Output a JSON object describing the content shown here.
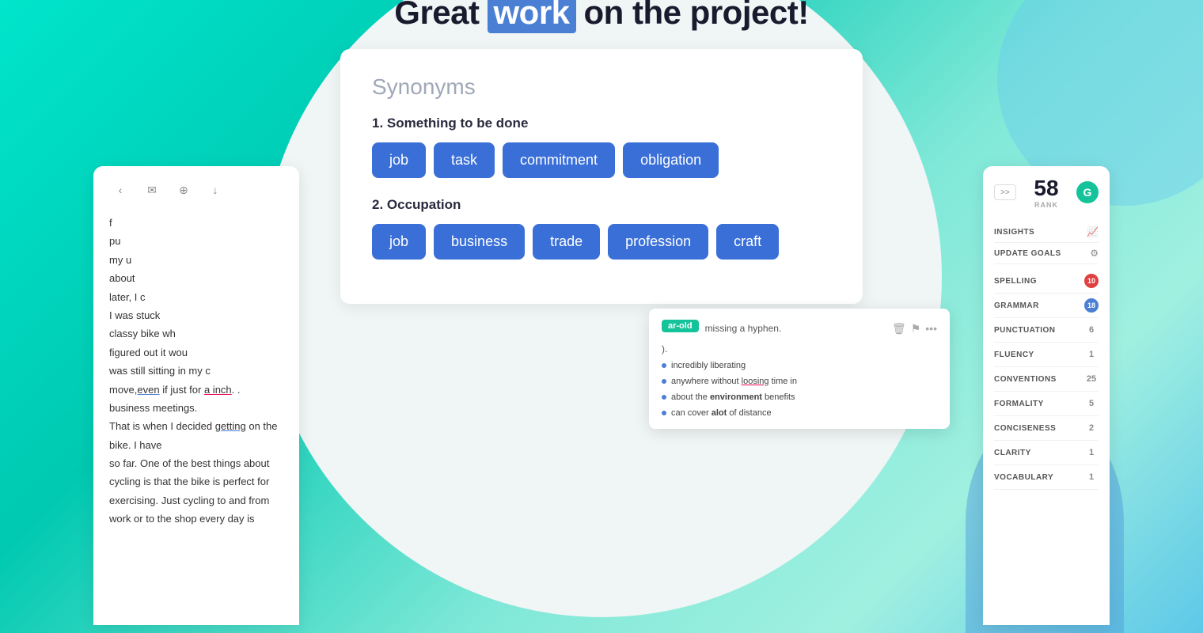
{
  "background": {
    "color_start": "#00e5cc",
    "color_end": "#5dc8e8"
  },
  "headline": {
    "pre": "Great",
    "highlighted_word": "work",
    "post": "on the project!"
  },
  "synonym_card": {
    "title": "Synonyms",
    "sections": [
      {
        "number": "1",
        "label": "Something to be done",
        "tags": [
          "job",
          "task",
          "commitment",
          "obligation"
        ]
      },
      {
        "number": "2",
        "label": "Occupation",
        "tags": [
          "job",
          "business",
          "trade",
          "profession",
          "craft"
        ]
      }
    ]
  },
  "left_panel": {
    "toolbar": {
      "back_icon": "‹ ✉",
      "add_icon": "+",
      "download_icon": "↓"
    },
    "text_lines": [
      "f",
      "pu",
      "my u",
      "about",
      "later, I c",
      "I was stuck",
      "classy bike wh",
      "figured out it wou",
      "was still sitting in my c",
      "move, even if just for a inch. .",
      "business meetings.",
      "That is when I decided getting on the bike. I have",
      "so far. One of the best things about cycling is that the bike is perfect for",
      "exercising. Just cycling to and from work or to the shop every day is"
    ]
  },
  "right_panel": {
    "score": "58",
    "score_label": "RANK",
    "logo_letter": "G",
    "expand_label": ">>",
    "menu_items": [
      {
        "label": "INSIGHTS",
        "badge": null,
        "badge_type": "icon",
        "icon": "📈"
      },
      {
        "label": "UPDATE GOALS",
        "badge": null,
        "badge_type": "icon",
        "icon": "⚙"
      },
      {
        "label": "SPELLING",
        "badge": "10",
        "badge_type": "red"
      },
      {
        "label": "GRAMMAR",
        "badge": "18",
        "badge_type": "blue"
      },
      {
        "label": "PUNCTUATION",
        "badge": "6",
        "badge_type": "gray"
      },
      {
        "label": "FLUENCY",
        "badge": "1",
        "badge_type": "gray"
      },
      {
        "label": "CONVENTIONS",
        "badge": "25",
        "badge_type": "gray"
      },
      {
        "label": "FORMALITY",
        "badge": "5",
        "badge_type": "gray"
      },
      {
        "label": "CONCISENESS",
        "badge": "2",
        "badge_type": "gray"
      },
      {
        "label": "CLARITY",
        "badge": "1",
        "badge_type": "gray"
      },
      {
        "label": "VOCABULARY",
        "badge": "1",
        "badge_type": "gray"
      }
    ]
  },
  "mid_panel": {
    "tag_text": "ar-old",
    "correction_text": "missing a hyphen.",
    "close_text": ").",
    "bullet_items": [
      {
        "text": "incredibly liberating"
      },
      {
        "text_pre": "anywhere without ",
        "highlight": "loosing",
        "text_post": " time in"
      }
    ]
  },
  "insights_label": "insighTS"
}
